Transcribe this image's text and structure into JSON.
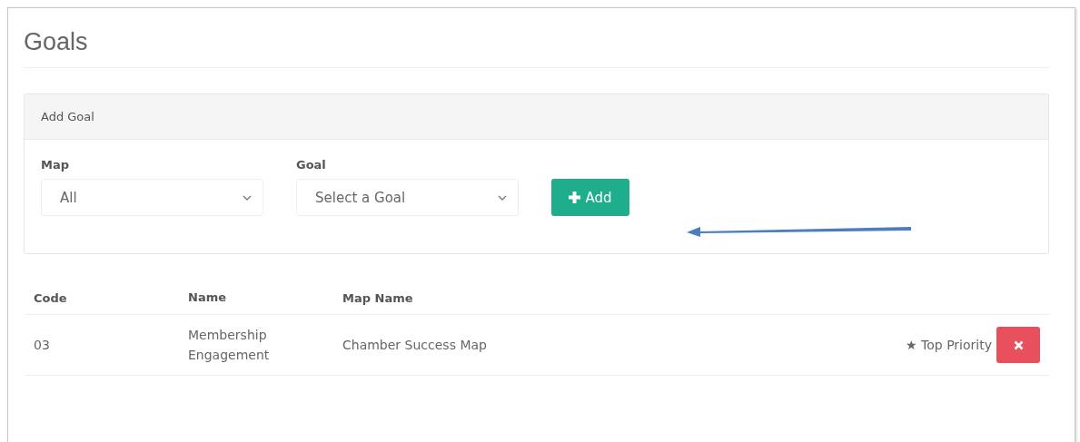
{
  "page": {
    "title": "Goals"
  },
  "add_goal": {
    "title": "Add Goal",
    "fields": [
      {
        "label": "Map",
        "value": "All"
      },
      {
        "label": "Goal",
        "value": "Select a Goal"
      }
    ],
    "button": "Add"
  },
  "table": {
    "columns": [
      "Code",
      "Name",
      "Map Name"
    ],
    "rows": [
      {
        "code": "03",
        "name": "Membership Engagement",
        "map_name": "Chamber Success Map",
        "priority": "★ Top Priority"
      }
    ]
  }
}
